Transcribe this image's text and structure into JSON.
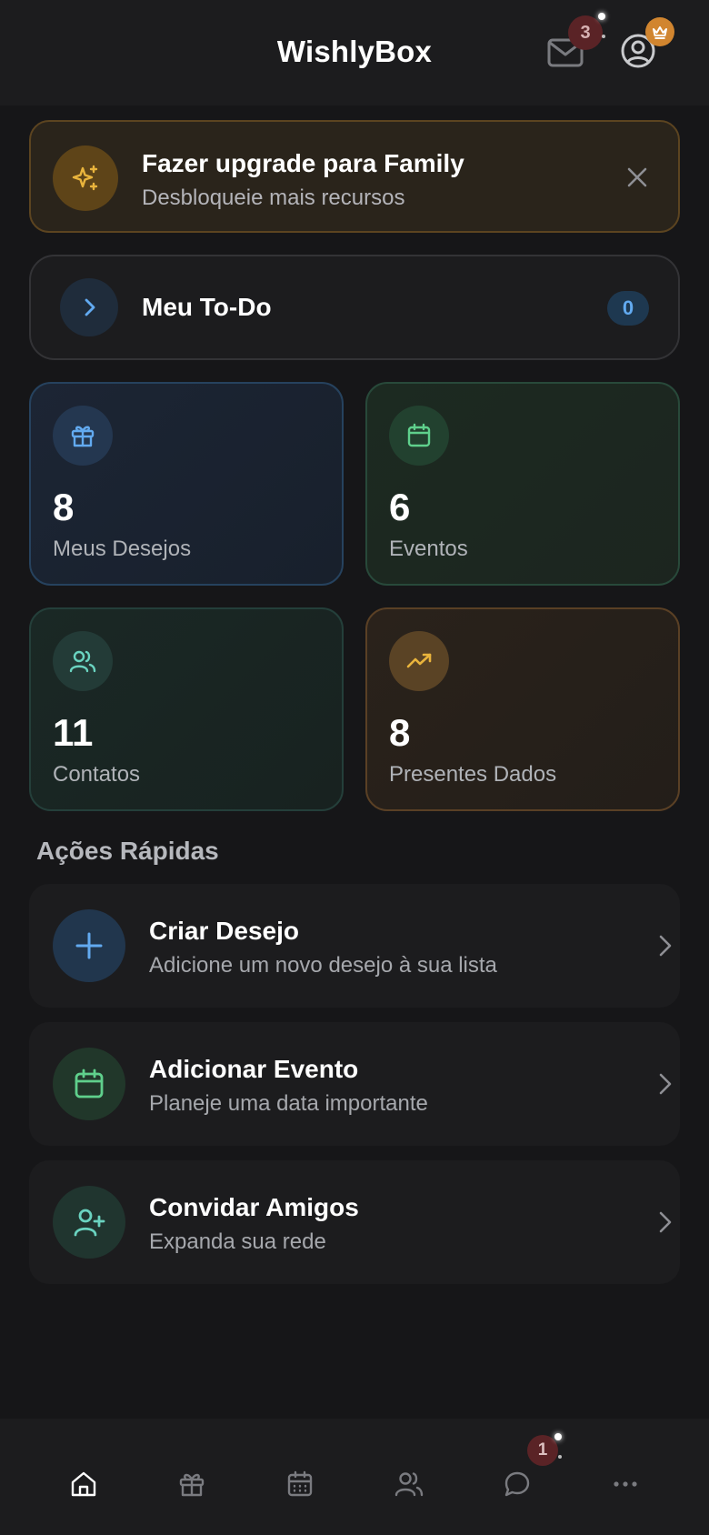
{
  "header": {
    "title": "WishlyBox",
    "mail_badge_count": "3"
  },
  "upgrade_banner": {
    "title": "Fazer upgrade para Family",
    "subtitle": "Desbloqueie mais recursos"
  },
  "todo": {
    "label": "Meu To-Do",
    "count": "0"
  },
  "stats": [
    {
      "value": "8",
      "label": "Meus Desejos",
      "icon": "gift-icon"
    },
    {
      "value": "6",
      "label": "Eventos",
      "icon": "calendar-icon"
    },
    {
      "value": "11",
      "label": "Contatos",
      "icon": "users-icon"
    },
    {
      "value": "8",
      "label": "Presentes Dados",
      "icon": "trending-up-icon"
    }
  ],
  "quick_actions": {
    "title": "Ações Rápidas",
    "items": [
      {
        "title": "Criar Desejo",
        "subtitle": "Adicione um novo desejo à sua lista",
        "icon": "plus-icon"
      },
      {
        "title": "Adicionar Evento",
        "subtitle": "Planeje uma data importante",
        "icon": "calendar-icon"
      },
      {
        "title": "Convidar Amigos",
        "subtitle": "Expanda sua rede",
        "icon": "user-plus-icon"
      }
    ]
  },
  "bottom_nav": {
    "items": [
      "home-icon",
      "gift-icon",
      "calendar-icon",
      "users-icon",
      "chat-icon",
      "more-icon"
    ],
    "chat_badge_count": "1"
  },
  "colors": {
    "background": "#161618",
    "surface": "#1c1c1e",
    "accent_blue": "#62aaf0",
    "accent_green": "#5fd08c",
    "accent_teal": "#6ad3c0",
    "accent_gold": "#e9b43c",
    "badge_red": "#5a2326",
    "crown_orange": "#d1852f"
  }
}
